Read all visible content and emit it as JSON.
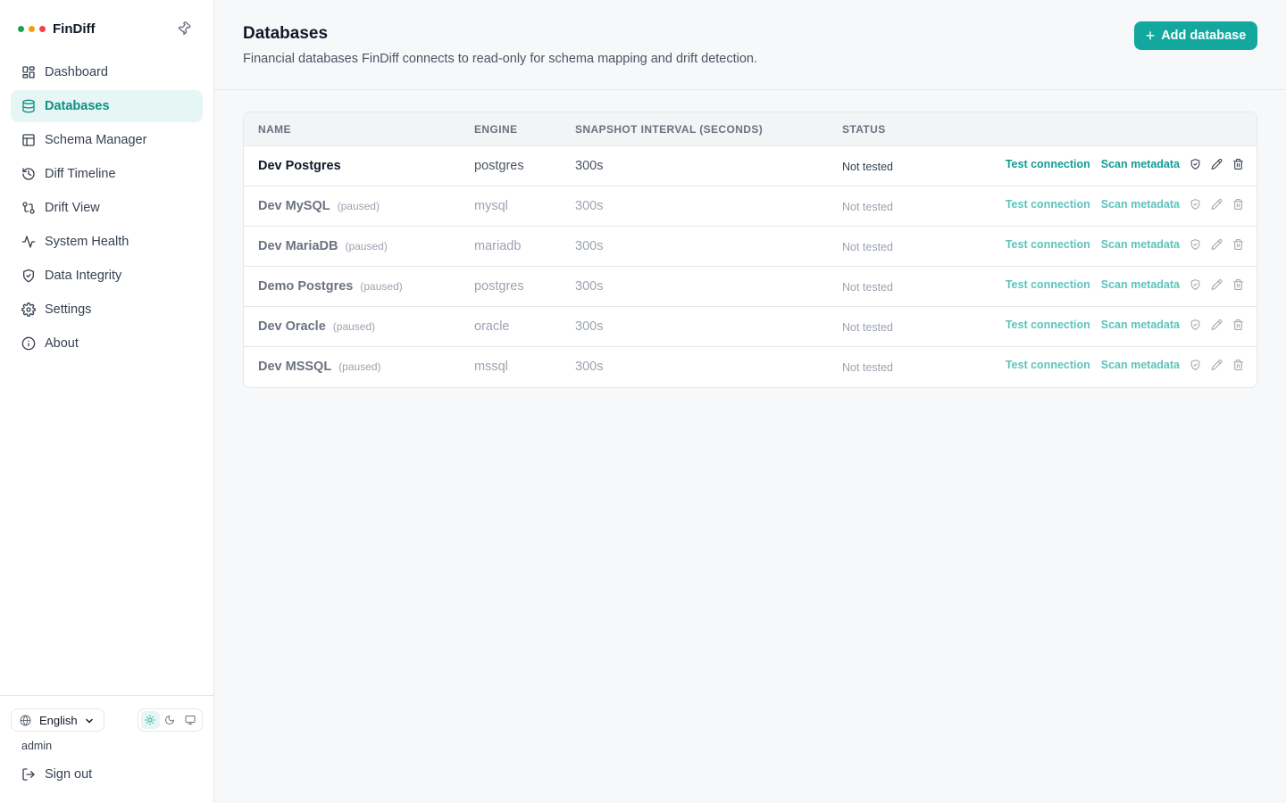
{
  "app": {
    "name": "FinDiff",
    "dots": [
      "#22a04b",
      "#f59e0b",
      "#ef4444"
    ]
  },
  "sidebar": {
    "items": [
      {
        "label": "Dashboard",
        "icon": "dashboard-icon"
      },
      {
        "label": "Databases",
        "icon": "database-icon",
        "active": true
      },
      {
        "label": "Schema Manager",
        "icon": "table-icon"
      },
      {
        "label": "Diff Timeline",
        "icon": "history-icon"
      },
      {
        "label": "Drift View",
        "icon": "git-compare-icon"
      },
      {
        "label": "System Health",
        "icon": "activity-icon"
      },
      {
        "label": "Data Integrity",
        "icon": "shield-icon"
      },
      {
        "label": "Settings",
        "icon": "gear-icon"
      },
      {
        "label": "About",
        "icon": "info-icon"
      }
    ],
    "language": "English",
    "theme_active": "light",
    "user": "admin",
    "sign_out": "Sign out"
  },
  "header": {
    "title": "Databases",
    "subtitle": "Financial databases FinDiff connects to read-only for schema mapping and drift detection.",
    "add_button": "Add database"
  },
  "table": {
    "columns": [
      "NAME",
      "ENGINE",
      "SNAPSHOT INTERVAL (SECONDS)",
      "STATUS"
    ],
    "actions": {
      "test": "Test connection",
      "scan": "Scan metadata"
    },
    "rows": [
      {
        "name": "Dev Postgres",
        "paused": "",
        "engine": "postgres",
        "interval": "300s",
        "status": "Not tested"
      },
      {
        "name": "Dev MySQL",
        "paused": "(paused)",
        "engine": "mysql",
        "interval": "300s",
        "status": "Not tested"
      },
      {
        "name": "Dev MariaDB",
        "paused": "(paused)",
        "engine": "mariadb",
        "interval": "300s",
        "status": "Not tested"
      },
      {
        "name": "Demo Postgres",
        "paused": "(paused)",
        "engine": "postgres",
        "interval": "300s",
        "status": "Not tested"
      },
      {
        "name": "Dev Oracle",
        "paused": "(paused)",
        "engine": "oracle",
        "interval": "300s",
        "status": "Not tested"
      },
      {
        "name": "Dev MSSQL",
        "paused": "(paused)",
        "engine": "mssql",
        "interval": "300s",
        "status": "Not tested"
      }
    ]
  },
  "colors": {
    "accent": "#13a89e",
    "accent_text": "#0f8f86",
    "active_bg": "#e6f6f4"
  }
}
